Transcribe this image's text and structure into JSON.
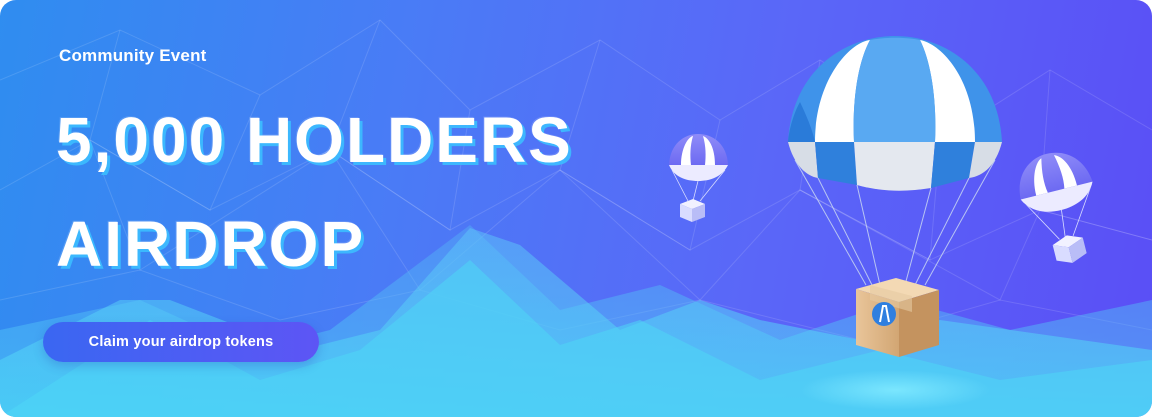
{
  "banner": {
    "eyebrow": "Community Event",
    "headline_line1": "5,000 HOLDERS",
    "headline_line2": "AIRDROP",
    "cta_label": "Claim your airdrop tokens"
  },
  "colors": {
    "background_start": "#2f8df0",
    "background_end": "#5a4ef6",
    "headline_shadow": "#3cbeff",
    "cta_start": "#3a67f2",
    "cta_end": "#5d55f5"
  },
  "icons": [
    "main-parachute-icon",
    "small-parachute-left-icon",
    "small-parachute-right-icon",
    "package-box-icon",
    "token-logo-icon"
  ]
}
